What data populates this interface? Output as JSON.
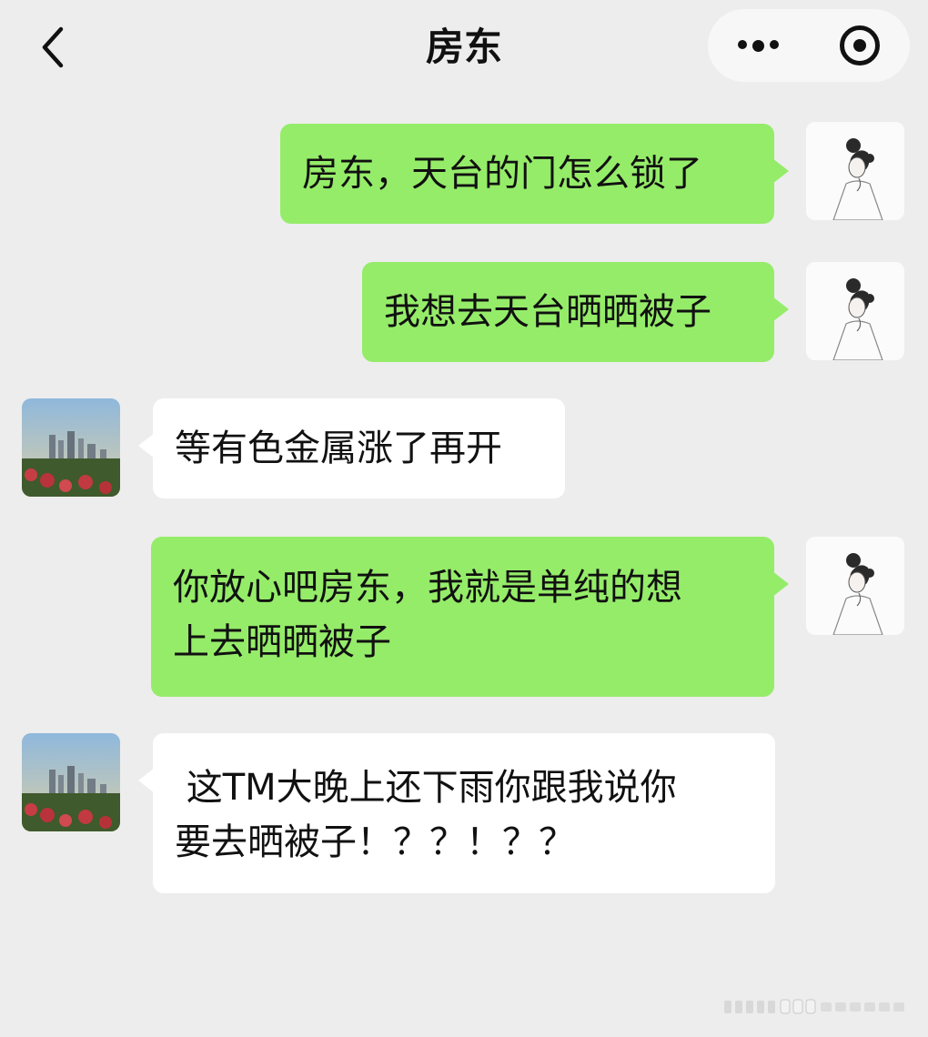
{
  "header": {
    "title": "房东",
    "back_icon": "chevron-left-icon",
    "more_icon": "more-dots-icon",
    "close_icon": "target-circle-icon"
  },
  "messages": [
    {
      "sender": "me",
      "text": "房东，天台的门怎么锁了"
    },
    {
      "sender": "me",
      "text": "我想去天台晒晒被子"
    },
    {
      "sender": "landlord",
      "text": "等有色金属涨了再开"
    },
    {
      "sender": "me",
      "text": "你放心吧房东，我就是单纯的想\n上去晒晒被子"
    },
    {
      "sender": "landlord",
      "text": " 这TM大晚上还下雨你跟我说你\n要去晒被子！？？！？？"
    }
  ],
  "colors": {
    "background": "#ededed",
    "my_bubble": "#95ec69",
    "other_bubble": "#ffffff",
    "text": "#111111"
  }
}
